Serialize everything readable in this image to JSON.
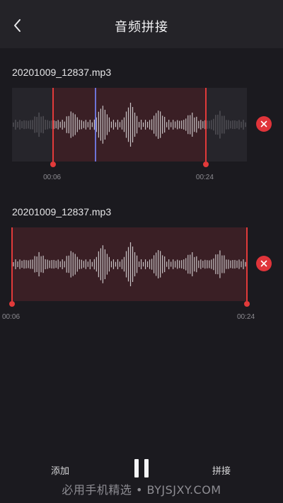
{
  "header": {
    "title": "音频拼接"
  },
  "clips": [
    {
      "filename": "20201009_12837.mp3",
      "start_label": "00:06",
      "end_label": "00:24",
      "selection_start": 0.175,
      "selection_end": 0.825,
      "playhead": 0.355
    },
    {
      "filename": "20201009_12837.mp3",
      "start_label": "00:06",
      "end_label": "00:24",
      "selection_start": 0.0,
      "selection_end": 1.0,
      "playhead": 0.0
    }
  ],
  "footer": {
    "add_label": "添加",
    "merge_label": "拼接",
    "watermark": "必用手机精选 • BYJSJXY.COM"
  },
  "colors": {
    "accent": "#e23a3a",
    "playhead": "#6d72d6",
    "selection": "#3a1f25",
    "background": "#1b1a1f"
  },
  "icons": {
    "back": "chevron-left-icon",
    "remove": "close-icon",
    "pause": "pause-icon"
  }
}
